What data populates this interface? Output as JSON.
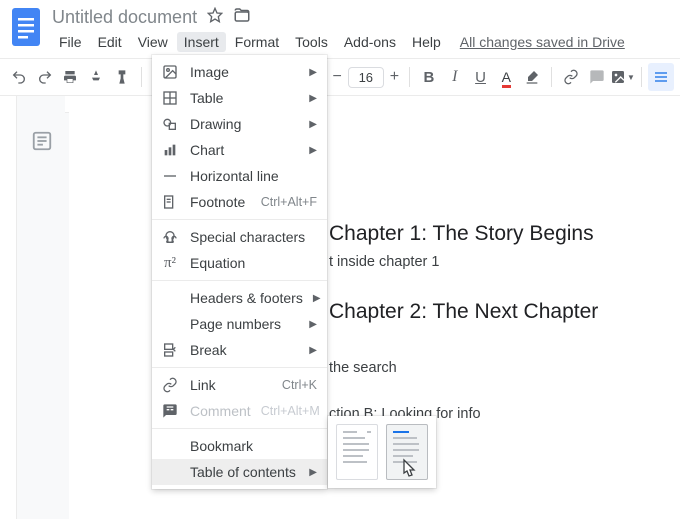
{
  "header": {
    "title": "Untitled document",
    "menus": [
      "File",
      "Edit",
      "View",
      "Insert",
      "Format",
      "Tools",
      "Add-ons",
      "Help"
    ],
    "active_menu_index": 3,
    "save_status": "All changes saved in Drive"
  },
  "toolbar": {
    "font_size": "16"
  },
  "insert_menu": {
    "items": [
      {
        "icon": "image",
        "label": "Image",
        "submenu": true
      },
      {
        "icon": "table",
        "label": "Table",
        "submenu": true
      },
      {
        "icon": "drawing",
        "label": "Drawing",
        "submenu": true
      },
      {
        "icon": "chart",
        "label": "Chart",
        "submenu": true
      },
      {
        "icon": "hr",
        "label": "Horizontal line"
      },
      {
        "icon": "footnote",
        "label": "Footnote",
        "shortcut": "Ctrl+Alt+F"
      },
      {
        "sep": true
      },
      {
        "icon": "special",
        "label": "Special characters"
      },
      {
        "icon": "equation",
        "label": "Equation"
      },
      {
        "sep": true
      },
      {
        "icon": "none",
        "label": "Headers & footers",
        "submenu": true
      },
      {
        "icon": "none",
        "label": "Page numbers",
        "submenu": true
      },
      {
        "icon": "break",
        "label": "Break",
        "submenu": true
      },
      {
        "sep": true
      },
      {
        "icon": "link",
        "label": "Link",
        "shortcut": "Ctrl+K"
      },
      {
        "icon": "comment",
        "label": "Comment",
        "shortcut": "Ctrl+Alt+M",
        "disabled": true
      },
      {
        "sep": true
      },
      {
        "icon": "none",
        "label": "Bookmark"
      },
      {
        "icon": "none",
        "label": "Table of contents",
        "submenu": true,
        "highlight": true
      }
    ]
  },
  "document": {
    "heading1": "Chapter 1: The Story Begins",
    "para1": "t inside chapter 1",
    "heading2": "Chapter 2: The Next Chapter",
    "para2": "the search",
    "para3": "ction B: Looking for info"
  }
}
